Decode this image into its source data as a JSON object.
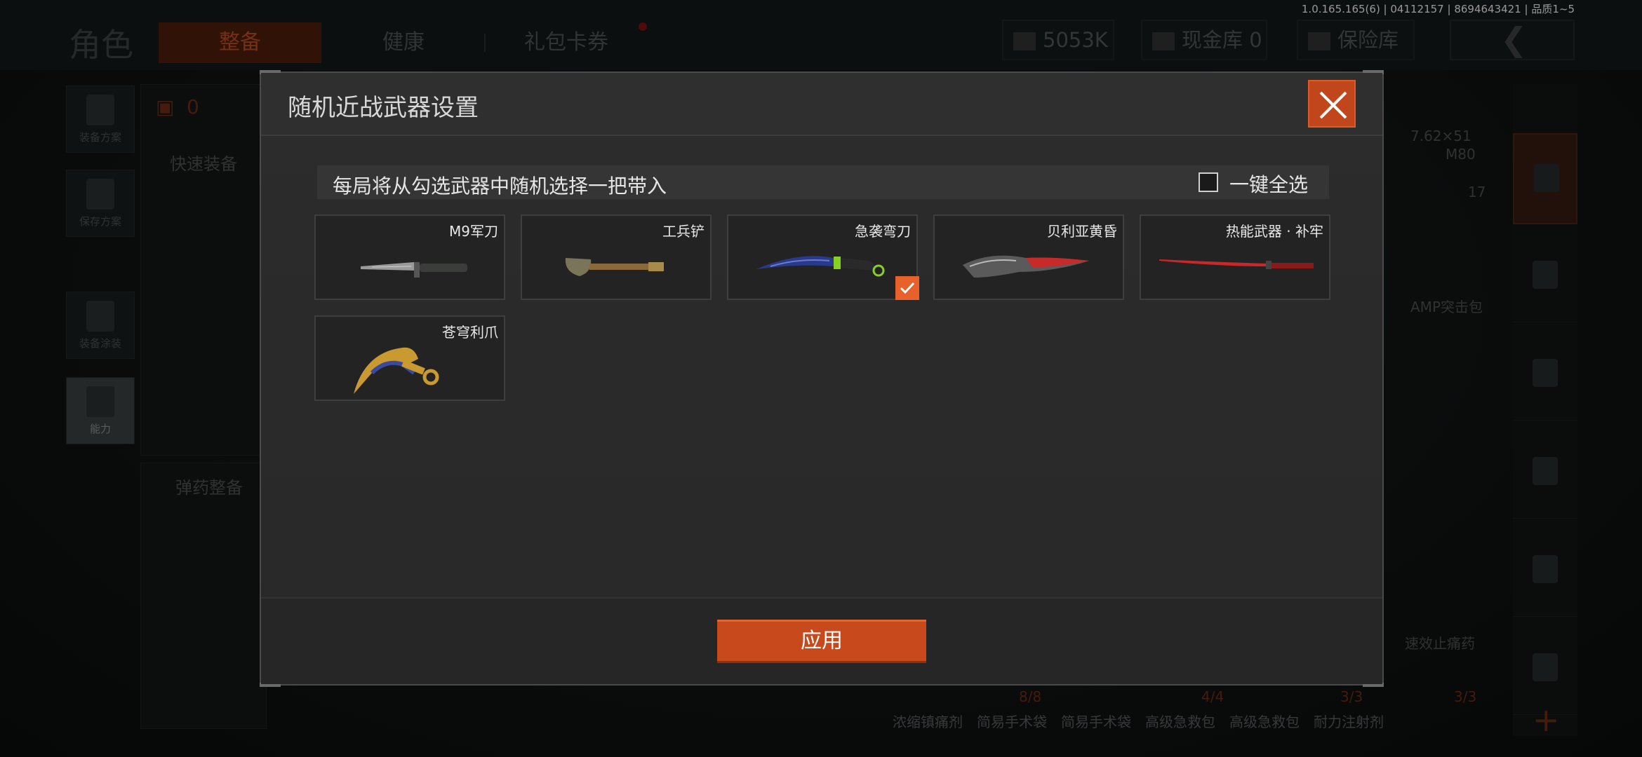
{
  "version": "1.0.165.165(6) | 04112157 | 8694643421 | 品质1~5",
  "background": {
    "title": "角色",
    "tabs": [
      "整备",
      "健康",
      "礼包卡券"
    ],
    "currency": "5053K",
    "cash_vault": "现金库 0",
    "safe": "保险库",
    "armor_count": "0",
    "side_buttons": [
      "装备方案",
      "保存方案",
      "装备涂装",
      "能力"
    ],
    "quick_equip": "快速装备",
    "ammo_manage": "弹药整备",
    "ammo_caliber": "7.62×51",
    "ammo_name": "M80",
    "ammo_count": "17",
    "amp_label": "AMP突击包",
    "med_label": "速效止痛药",
    "bottom_items": [
      "浓缩镇痛剂",
      "简易手术袋",
      "简易手术袋",
      "高级急救包",
      "高级急救包",
      "耐力注射剂"
    ],
    "bottom_counts": [
      "8/8",
      "4/4",
      "3/3",
      "3/3"
    ]
  },
  "modal": {
    "title": "随机近战武器设置",
    "info": "每局将从勾选武器中随机选择一把带入",
    "select_all": "一键全选",
    "apply": "应用",
    "weapons": [
      {
        "name": "M9军刀",
        "checked": false
      },
      {
        "name": "工兵铲",
        "checked": false
      },
      {
        "name": "急袭弯刀",
        "checked": true
      },
      {
        "name": "贝利亚黄昏",
        "checked": false
      },
      {
        "name": "热能武器 · 补牢",
        "checked": false
      },
      {
        "name": "苍穹利爪",
        "checked": false
      }
    ]
  },
  "colors": {
    "accent": "#c84a1c",
    "check": "#e8612a",
    "panel": "#2a2a2a"
  }
}
